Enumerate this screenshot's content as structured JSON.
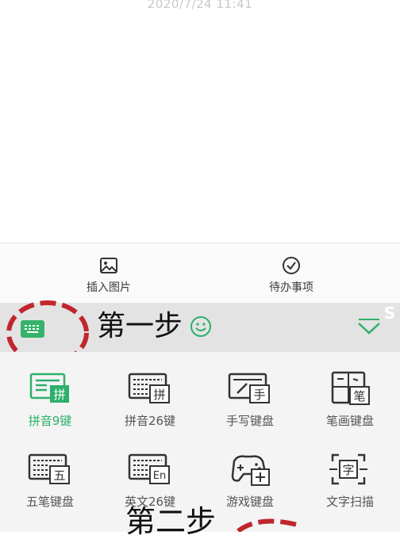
{
  "note": {
    "timestamp": "2020/7/24 11:41"
  },
  "toolbar": {
    "insert_image": {
      "label": "插入图片",
      "icon": "image-icon"
    },
    "todo": {
      "label": "待办事项",
      "icon": "check-circle-icon"
    }
  },
  "keyboard_bar": {
    "step1_text": "第一步",
    "step1_emoji": "smiley-icon",
    "collapse_icon": "chevron-down-icon",
    "corner_mark": "S"
  },
  "keyboards": [
    {
      "label": "拼音9键",
      "glyph": "拼",
      "active": true
    },
    {
      "label": "拼音26键",
      "glyph": "拼",
      "active": false
    },
    {
      "label": "手写键盘",
      "glyph": "手",
      "active": false
    },
    {
      "label": "笔画键盘",
      "glyph": "笔",
      "active": false
    },
    {
      "label": "五笔键盘",
      "glyph": "五",
      "active": false
    },
    {
      "label": "英文26键",
      "glyph": "En",
      "active": false
    },
    {
      "label": "游戏键盘",
      "glyph": "",
      "active": false
    },
    {
      "label": "文字扫描",
      "glyph": "字",
      "active": false
    }
  ],
  "step2_text": "第二步",
  "colors": {
    "accent": "#2db06a",
    "annotation": "#c0262e",
    "keyboard_bar": "#e3e3e3"
  }
}
